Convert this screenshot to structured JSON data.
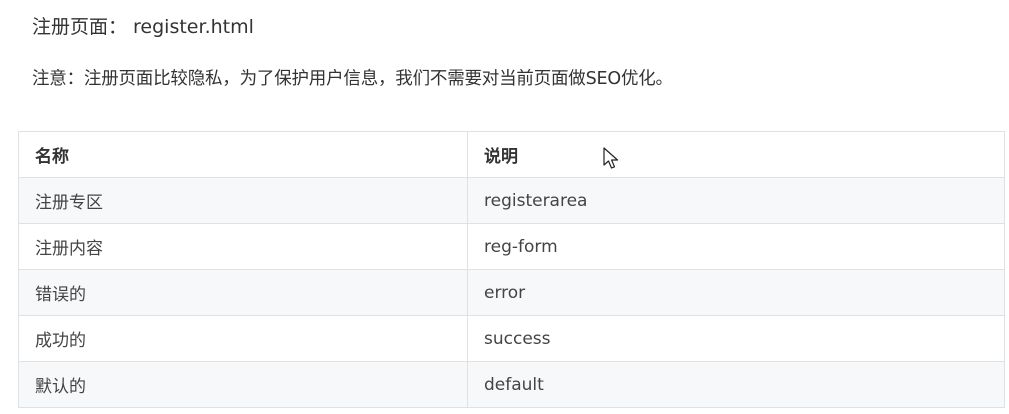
{
  "page": {
    "register_line": "注册页面： register.html",
    "note_line": "注意：注册页面比较隐私，为了保护用户信息，我们不需要对当前页面做SEO优化。"
  },
  "table": {
    "headers": [
      "名称",
      "说明"
    ],
    "rows": [
      [
        "注册专区",
        "registerarea"
      ],
      [
        "注册内容",
        "reg-form"
      ],
      [
        "错误的",
        "error"
      ],
      [
        "成功的",
        "success"
      ],
      [
        "默认的",
        "default"
      ]
    ]
  },
  "icons": {
    "cursor": "mouse-pointer-icon"
  },
  "colors": {
    "row_stripe": "#f6f8fa",
    "border": "#dfe2e5",
    "text": "#333333"
  }
}
